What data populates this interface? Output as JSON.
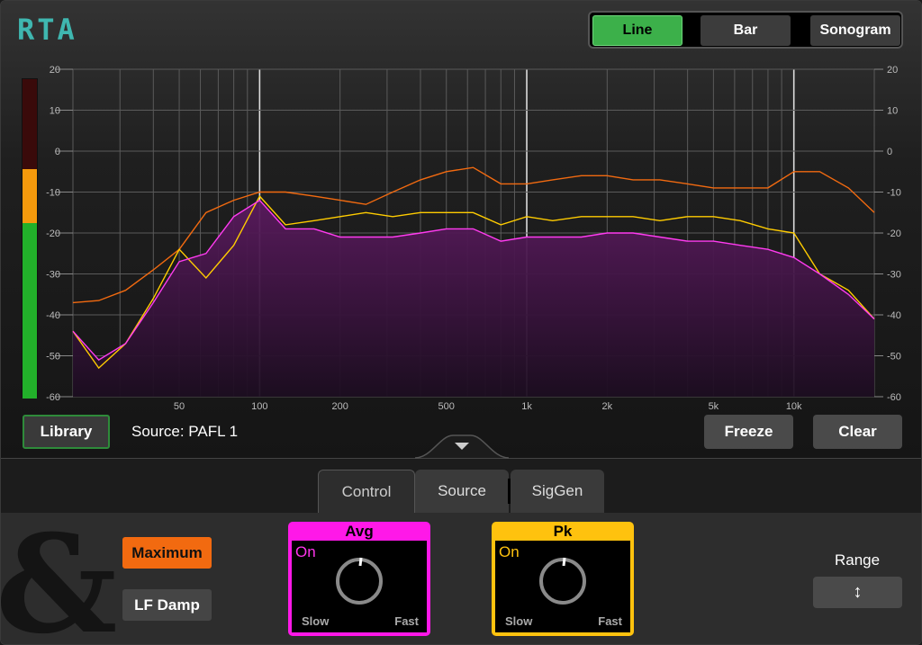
{
  "app": {
    "logo": "RTA"
  },
  "modes": {
    "line": "Line",
    "bar": "Bar",
    "sonogram": "Sonogram",
    "active": "Line"
  },
  "plot": {
    "y_ticks": [
      "20",
      "10",
      "0",
      "-10",
      "-20",
      "-30",
      "-40",
      "-50",
      "-60"
    ],
    "y_values": [
      20,
      10,
      0,
      -10,
      -20,
      -30,
      -40,
      -50,
      -60
    ],
    "x_labels": [
      "50",
      "100",
      "200",
      "500",
      "1k",
      "2k",
      "5k",
      "10k"
    ],
    "x_label_values": [
      50,
      100,
      200,
      500,
      1000,
      2000,
      5000,
      10000
    ],
    "x_range": [
      20,
      20000
    ],
    "y_range": [
      -60,
      20
    ],
    "colors": {
      "avg": "#ff3bf0",
      "pk": "#ffcc00",
      "max": "#f26a10",
      "grid": "#5a5a5a",
      "major": "#dcdcdc"
    }
  },
  "chart_data": {
    "type": "line",
    "x_scale": "log",
    "xlim": [
      20,
      20000
    ],
    "ylim": [
      -60,
      20
    ],
    "x": [
      20,
      25,
      31.5,
      40,
      50,
      63,
      80,
      100,
      125,
      160,
      200,
      250,
      315,
      400,
      500,
      630,
      800,
      1000,
      1250,
      1600,
      2000,
      2500,
      3150,
      4000,
      5000,
      6300,
      8000,
      10000,
      12500,
      16000,
      20000
    ],
    "series": [
      {
        "name": "Maximum",
        "values": [
          -37,
          -36.5,
          -34,
          -29,
          -24,
          -15,
          -12,
          -10,
          -10,
          -11,
          -12,
          -13,
          -10,
          -7,
          -5,
          -4,
          -8,
          -8,
          -7,
          -6,
          -6,
          -7,
          -7,
          -8,
          -9,
          -9,
          -9,
          -5,
          -5,
          -9,
          -15
        ]
      },
      {
        "name": "Pk",
        "values": [
          -44,
          -53,
          -47,
          -36,
          -24,
          -31,
          -23,
          -11,
          -18,
          -17,
          -16,
          -15,
          -16,
          -15,
          -15,
          -15,
          -18,
          -16,
          -17,
          -16,
          -16,
          -16,
          -17,
          -16,
          -16,
          -17,
          -19,
          -20,
          -30,
          -34,
          -41
        ]
      },
      {
        "name": "Avg",
        "values": [
          -44,
          -51,
          -47,
          -37,
          -27,
          -25,
          -16,
          -12,
          -19,
          -19,
          -21,
          -21,
          -21,
          -20,
          -19,
          -19,
          -22,
          -21,
          -21,
          -21,
          -20,
          -20,
          -21,
          -22,
          -22,
          -23,
          -24,
          -26,
          -30,
          -35,
          -41
        ]
      }
    ]
  },
  "meter": {
    "level": 0.45
  },
  "toolbar": {
    "library": "Library",
    "source": "Source: PAFL 1",
    "freeze": "Freeze",
    "clear": "Clear"
  },
  "tabs": {
    "control": "Control",
    "source": "Source",
    "siggen": "SigGen"
  },
  "control": {
    "maximum": "Maximum",
    "lf_damp": "LF Damp",
    "avg": {
      "title": "Avg",
      "state": "On",
      "slow": "Slow",
      "fast": "Fast"
    },
    "pk": {
      "title": "Pk",
      "state": "On",
      "slow": "Slow",
      "fast": "Fast"
    },
    "range_label": "Range",
    "range_icon": "↕"
  }
}
